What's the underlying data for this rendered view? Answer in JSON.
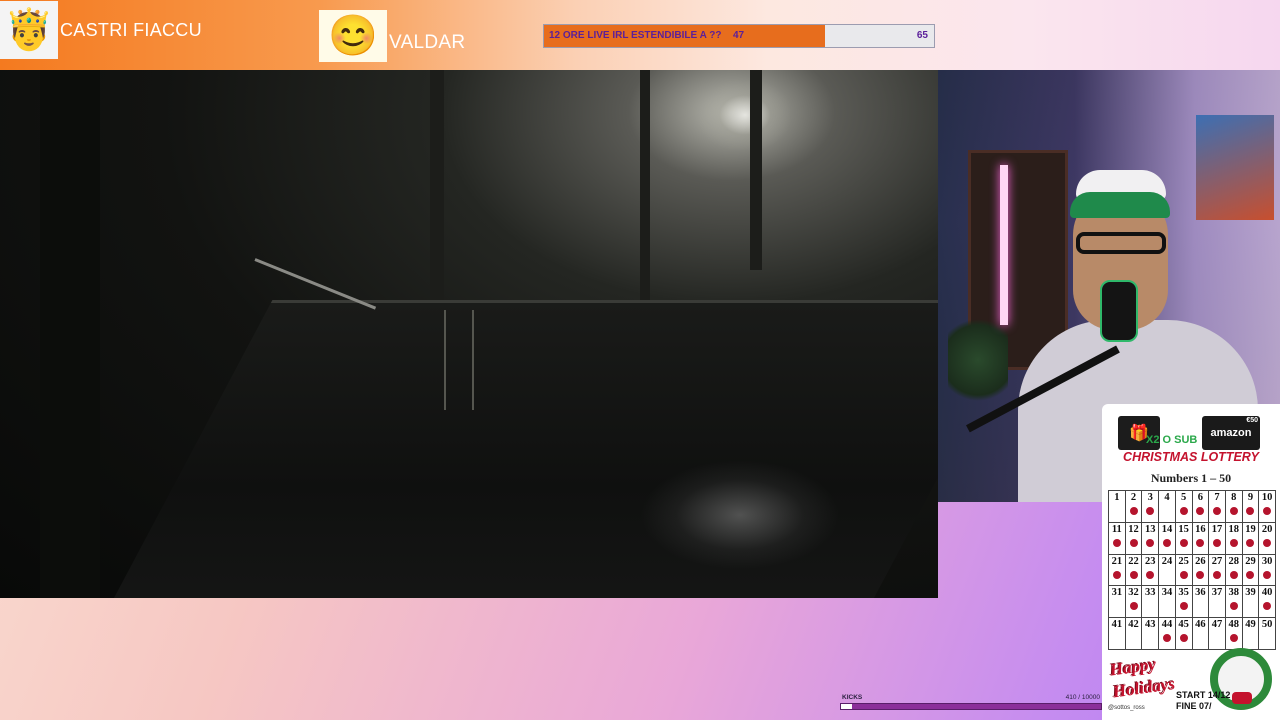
{
  "players": [
    {
      "name": "CASTRI FIACCU",
      "avatar_icon": "king-emoji-icon"
    },
    {
      "name": "VALDAR",
      "avatar_icon": "king-emoji-trophy-icon"
    }
  ],
  "vote": {
    "question": "12 ORE LIVE IRL ESTENDIBILE A ??",
    "value_a": "47",
    "value_b": "65",
    "fill_fraction": 0.72,
    "fill_color": "#e76d1d"
  },
  "lottery": {
    "gift_label": "🎁",
    "amazon_label": "amazon",
    "amazon_amount": "€50",
    "sub_text": "X2 O SUB",
    "title": "CHRISTMAS LOTTERY",
    "range": "Numbers 1 – 50",
    "numbers": [
      "1",
      "2",
      "3",
      "4",
      "5",
      "6",
      "7",
      "8",
      "9",
      "10",
      "11",
      "12",
      "13",
      "14",
      "15",
      "16",
      "17",
      "18",
      "19",
      "20",
      "21",
      "22",
      "23",
      "24",
      "25",
      "26",
      "27",
      "28",
      "29",
      "30",
      "31",
      "32",
      "33",
      "34",
      "35",
      "36",
      "37",
      "38",
      "39",
      "40",
      "41",
      "42",
      "43",
      "44",
      "45",
      "46",
      "47",
      "48",
      "49",
      "50"
    ],
    "marked": [
      "2",
      "3",
      "5",
      "6",
      "7",
      "8",
      "9",
      "10",
      "11",
      "12",
      "13",
      "14",
      "15",
      "16",
      "17",
      "18",
      "19",
      "20",
      "21",
      "22",
      "23",
      "25",
      "26",
      "27",
      "28",
      "29",
      "30",
      "32",
      "35",
      "38",
      "40",
      "44",
      "45",
      "48"
    ],
    "happy_text": "Happy Holidays",
    "start_text": "START 14/12",
    "end_text": "FINE 07/",
    "handle": "@sottos_ross",
    "accent": "#c4122d"
  },
  "kicks": {
    "label": "KICKS",
    "count": "410 / 10000",
    "progress": 0.041
  }
}
